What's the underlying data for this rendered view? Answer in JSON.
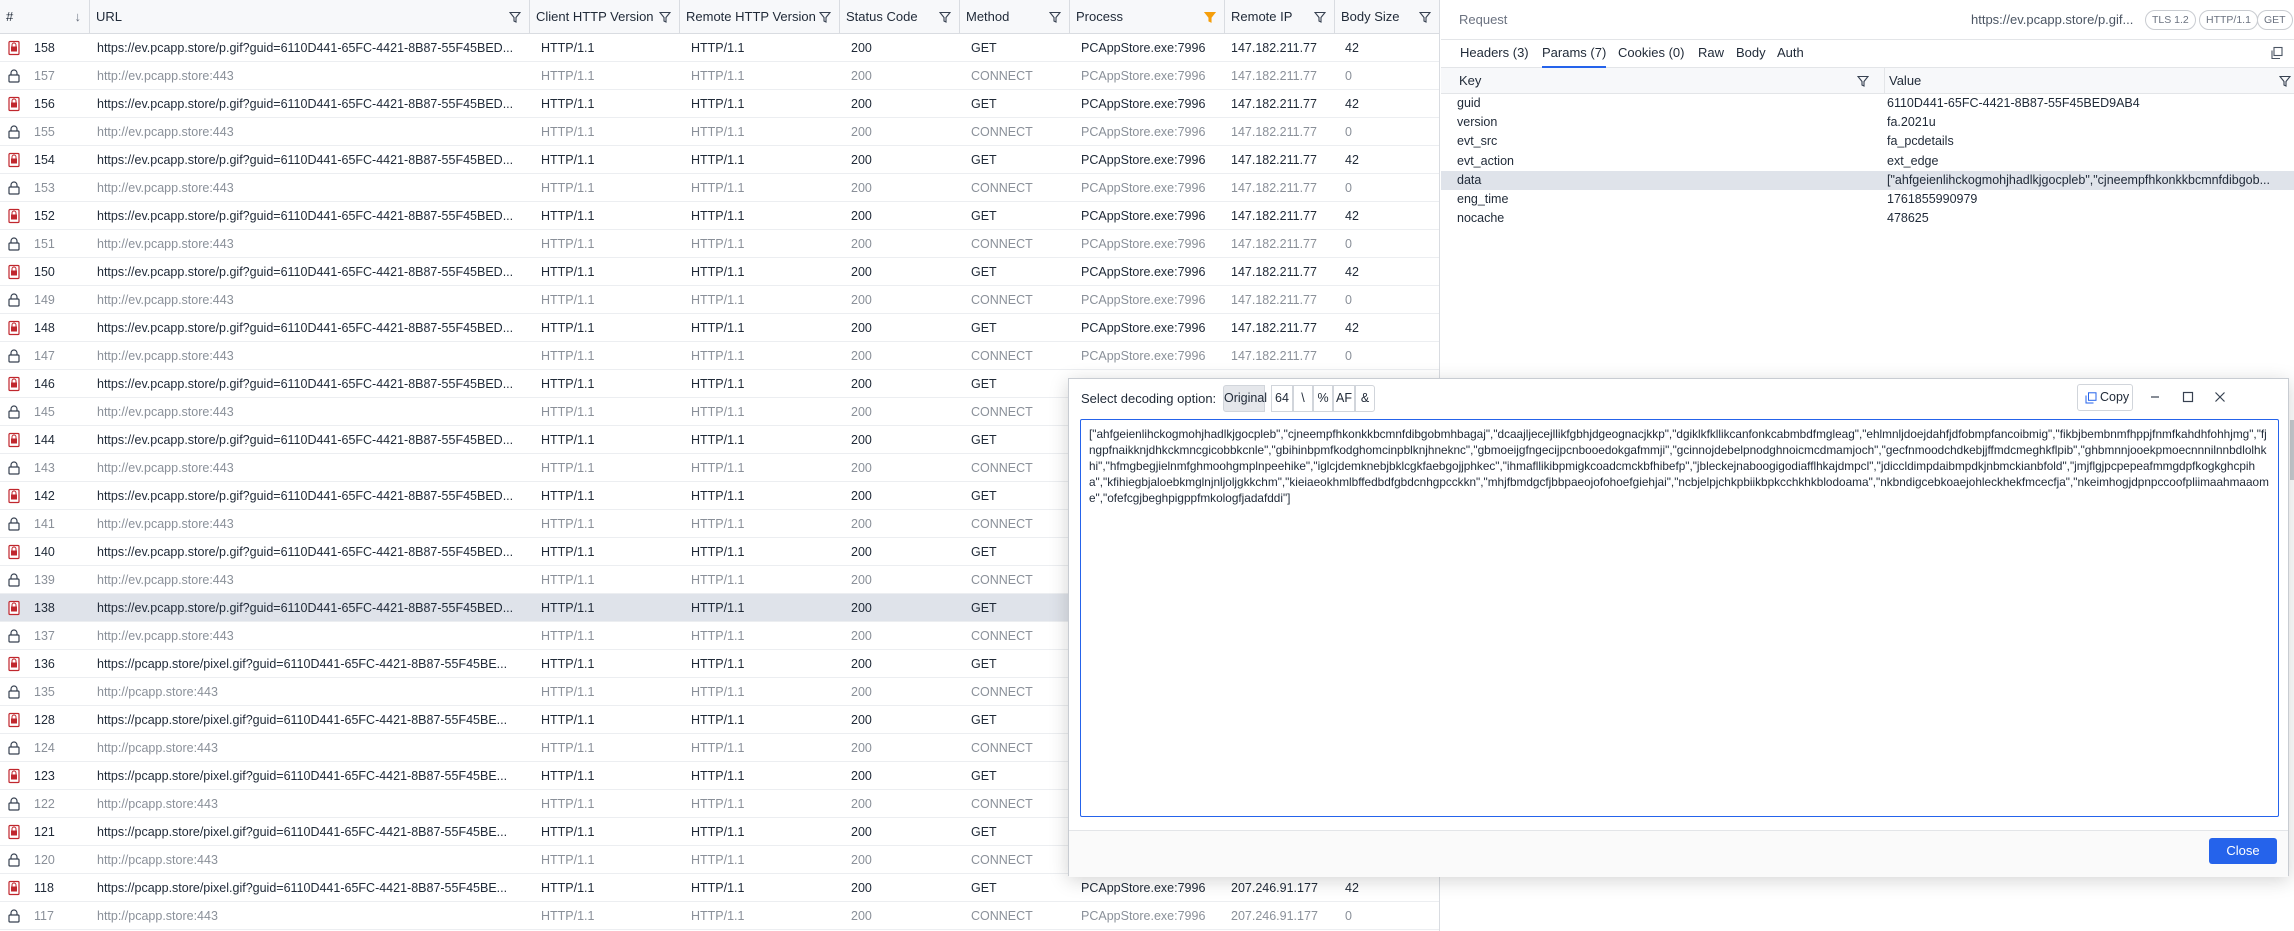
{
  "columns": {
    "num": "#",
    "url": "URL",
    "client_http": "Client HTTP Version",
    "remote_http": "Remote HTTP Version",
    "status": "Status Code",
    "method": "Method",
    "process": "Process",
    "remote_ip": "Remote IP",
    "body_size": "Body Size"
  },
  "colors": {
    "accent": "#2563eb",
    "https_icon": "#c0262d",
    "filter_active": "#f59e0b",
    "selected_row": "#dfe3ea"
  },
  "rows": [
    {
      "num": "158",
      "type": "req",
      "url": "https://ev.pcapp.store/p.gif?guid=6110D441-65FC-4421-8B87-55F45BED...",
      "client": "HTTP/1.1",
      "remote": "HTTP/1.1",
      "status": "200",
      "method": "GET",
      "process": "PCAppStore.exe:7996",
      "ip": "147.182.211.77",
      "size": "42"
    },
    {
      "num": "157",
      "type": "conn",
      "url": "http://ev.pcapp.store:443",
      "client": "HTTP/1.1",
      "remote": "HTTP/1.1",
      "status": "200",
      "method": "CONNECT",
      "process": "PCAppStore.exe:7996",
      "ip": "147.182.211.77",
      "size": "0"
    },
    {
      "num": "156",
      "type": "req",
      "url": "https://ev.pcapp.store/p.gif?guid=6110D441-65FC-4421-8B87-55F45BED...",
      "client": "HTTP/1.1",
      "remote": "HTTP/1.1",
      "status": "200",
      "method": "GET",
      "process": "PCAppStore.exe:7996",
      "ip": "147.182.211.77",
      "size": "42"
    },
    {
      "num": "155",
      "type": "conn",
      "url": "http://ev.pcapp.store:443",
      "client": "HTTP/1.1",
      "remote": "HTTP/1.1",
      "status": "200",
      "method": "CONNECT",
      "process": "PCAppStore.exe:7996",
      "ip": "147.182.211.77",
      "size": "0"
    },
    {
      "num": "154",
      "type": "req",
      "url": "https://ev.pcapp.store/p.gif?guid=6110D441-65FC-4421-8B87-55F45BED...",
      "client": "HTTP/1.1",
      "remote": "HTTP/1.1",
      "status": "200",
      "method": "GET",
      "process": "PCAppStore.exe:7996",
      "ip": "147.182.211.77",
      "size": "42"
    },
    {
      "num": "153",
      "type": "conn",
      "url": "http://ev.pcapp.store:443",
      "client": "HTTP/1.1",
      "remote": "HTTP/1.1",
      "status": "200",
      "method": "CONNECT",
      "process": "PCAppStore.exe:7996",
      "ip": "147.182.211.77",
      "size": "0"
    },
    {
      "num": "152",
      "type": "req",
      "url": "https://ev.pcapp.store/p.gif?guid=6110D441-65FC-4421-8B87-55F45BED...",
      "client": "HTTP/1.1",
      "remote": "HTTP/1.1",
      "status": "200",
      "method": "GET",
      "process": "PCAppStore.exe:7996",
      "ip": "147.182.211.77",
      "size": "42"
    },
    {
      "num": "151",
      "type": "conn",
      "url": "http://ev.pcapp.store:443",
      "client": "HTTP/1.1",
      "remote": "HTTP/1.1",
      "status": "200",
      "method": "CONNECT",
      "process": "PCAppStore.exe:7996",
      "ip": "147.182.211.77",
      "size": "0"
    },
    {
      "num": "150",
      "type": "req",
      "url": "https://ev.pcapp.store/p.gif?guid=6110D441-65FC-4421-8B87-55F45BED...",
      "client": "HTTP/1.1",
      "remote": "HTTP/1.1",
      "status": "200",
      "method": "GET",
      "process": "PCAppStore.exe:7996",
      "ip": "147.182.211.77",
      "size": "42"
    },
    {
      "num": "149",
      "type": "conn",
      "url": "http://ev.pcapp.store:443",
      "client": "HTTP/1.1",
      "remote": "HTTP/1.1",
      "status": "200",
      "method": "CONNECT",
      "process": "PCAppStore.exe:7996",
      "ip": "147.182.211.77",
      "size": "0"
    },
    {
      "num": "148",
      "type": "req",
      "url": "https://ev.pcapp.store/p.gif?guid=6110D441-65FC-4421-8B87-55F45BED...",
      "client": "HTTP/1.1",
      "remote": "HTTP/1.1",
      "status": "200",
      "method": "GET",
      "process": "PCAppStore.exe:7996",
      "ip": "147.182.211.77",
      "size": "42"
    },
    {
      "num": "147",
      "type": "conn",
      "url": "http://ev.pcapp.store:443",
      "client": "HTTP/1.1",
      "remote": "HTTP/1.1",
      "status": "200",
      "method": "CONNECT",
      "process": "PCAppStore.exe:7996",
      "ip": "147.182.211.77",
      "size": "0"
    },
    {
      "num": "146",
      "type": "req",
      "url": "https://ev.pcapp.store/p.gif?guid=6110D441-65FC-4421-8B87-55F45BED...",
      "client": "HTTP/1.1",
      "remote": "HTTP/1.1",
      "status": "200",
      "method": "GET",
      "process": "",
      "ip": "",
      "size": ""
    },
    {
      "num": "145",
      "type": "conn",
      "url": "http://ev.pcapp.store:443",
      "client": "HTTP/1.1",
      "remote": "HTTP/1.1",
      "status": "200",
      "method": "CONNECT",
      "process": "",
      "ip": "",
      "size": ""
    },
    {
      "num": "144",
      "type": "req",
      "url": "https://ev.pcapp.store/p.gif?guid=6110D441-65FC-4421-8B87-55F45BED...",
      "client": "HTTP/1.1",
      "remote": "HTTP/1.1",
      "status": "200",
      "method": "GET",
      "process": "",
      "ip": "",
      "size": ""
    },
    {
      "num": "143",
      "type": "conn",
      "url": "http://ev.pcapp.store:443",
      "client": "HTTP/1.1",
      "remote": "HTTP/1.1",
      "status": "200",
      "method": "CONNECT",
      "process": "",
      "ip": "",
      "size": ""
    },
    {
      "num": "142",
      "type": "req",
      "url": "https://ev.pcapp.store/p.gif?guid=6110D441-65FC-4421-8B87-55F45BED...",
      "client": "HTTP/1.1",
      "remote": "HTTP/1.1",
      "status": "200",
      "method": "GET",
      "process": "",
      "ip": "",
      "size": ""
    },
    {
      "num": "141",
      "type": "conn",
      "url": "http://ev.pcapp.store:443",
      "client": "HTTP/1.1",
      "remote": "HTTP/1.1",
      "status": "200",
      "method": "CONNECT",
      "process": "",
      "ip": "",
      "size": ""
    },
    {
      "num": "140",
      "type": "req",
      "url": "https://ev.pcapp.store/p.gif?guid=6110D441-65FC-4421-8B87-55F45BED...",
      "client": "HTTP/1.1",
      "remote": "HTTP/1.1",
      "status": "200",
      "method": "GET",
      "process": "",
      "ip": "",
      "size": ""
    },
    {
      "num": "139",
      "type": "conn",
      "url": "http://ev.pcapp.store:443",
      "client": "HTTP/1.1",
      "remote": "HTTP/1.1",
      "status": "200",
      "method": "CONNECT",
      "process": "",
      "ip": "",
      "size": ""
    },
    {
      "num": "138",
      "type": "req",
      "sel": true,
      "url": "https://ev.pcapp.store/p.gif?guid=6110D441-65FC-4421-8B87-55F45BED...",
      "client": "HTTP/1.1",
      "remote": "HTTP/1.1",
      "status": "200",
      "method": "GET",
      "process": "",
      "ip": "",
      "size": ""
    },
    {
      "num": "137",
      "type": "conn",
      "url": "http://ev.pcapp.store:443",
      "client": "HTTP/1.1",
      "remote": "HTTP/1.1",
      "status": "200",
      "method": "CONNECT",
      "process": "",
      "ip": "",
      "size": ""
    },
    {
      "num": "136",
      "type": "req",
      "url": "https://pcapp.store/pixel.gif?guid=6110D441-65FC-4421-8B87-55F45BE...",
      "client": "HTTP/1.1",
      "remote": "HTTP/1.1",
      "status": "200",
      "method": "GET",
      "process": "",
      "ip": "",
      "size": ""
    },
    {
      "num": "135",
      "type": "conn",
      "url": "http://pcapp.store:443",
      "client": "HTTP/1.1",
      "remote": "HTTP/1.1",
      "status": "200",
      "method": "CONNECT",
      "process": "",
      "ip": "",
      "size": ""
    },
    {
      "num": "128",
      "type": "req",
      "url": "https://pcapp.store/pixel.gif?guid=6110D441-65FC-4421-8B87-55F45BE...",
      "client": "HTTP/1.1",
      "remote": "HTTP/1.1",
      "status": "200",
      "method": "GET",
      "process": "",
      "ip": "",
      "size": ""
    },
    {
      "num": "124",
      "type": "conn",
      "url": "http://pcapp.store:443",
      "client": "HTTP/1.1",
      "remote": "HTTP/1.1",
      "status": "200",
      "method": "CONNECT",
      "process": "",
      "ip": "",
      "size": ""
    },
    {
      "num": "123",
      "type": "req",
      "url": "https://pcapp.store/pixel.gif?guid=6110D441-65FC-4421-8B87-55F45BE...",
      "client": "HTTP/1.1",
      "remote": "HTTP/1.1",
      "status": "200",
      "method": "GET",
      "process": "",
      "ip": "",
      "size": ""
    },
    {
      "num": "122",
      "type": "conn",
      "url": "http://pcapp.store:443",
      "client": "HTTP/1.1",
      "remote": "HTTP/1.1",
      "status": "200",
      "method": "CONNECT",
      "process": "",
      "ip": "",
      "size": ""
    },
    {
      "num": "121",
      "type": "req",
      "url": "https://pcapp.store/pixel.gif?guid=6110D441-65FC-4421-8B87-55F45BE...",
      "client": "HTTP/1.1",
      "remote": "HTTP/1.1",
      "status": "200",
      "method": "GET",
      "process": "",
      "ip": "",
      "size": ""
    },
    {
      "num": "120",
      "type": "conn",
      "url": "http://pcapp.store:443",
      "client": "HTTP/1.1",
      "remote": "HTTP/1.1",
      "status": "200",
      "method": "CONNECT",
      "process": "",
      "ip": "",
      "size": ""
    },
    {
      "num": "118",
      "type": "req",
      "url": "https://pcapp.store/pixel.gif?guid=6110D441-65FC-4421-8B87-55F45BE...",
      "client": "HTTP/1.1",
      "remote": "HTTP/1.1",
      "status": "200",
      "method": "GET",
      "process": "PCAppStore.exe:7996",
      "ip": "207.246.91.177",
      "size": "42"
    },
    {
      "num": "117",
      "type": "conn",
      "url": "http://pcapp.store:443",
      "client": "HTTP/1.1",
      "remote": "HTTP/1.1",
      "status": "200",
      "method": "CONNECT",
      "process": "PCAppStore.exe:7996",
      "ip": "207.246.91.177",
      "size": "0"
    }
  ],
  "inspector": {
    "section_label": "Request",
    "url": "https://ev.pcapp.store/p.gif...",
    "badges": [
      "TLS 1.2",
      "HTTP/1.1",
      "GET"
    ],
    "tabs": [
      "Headers (3)",
      "Params (7)",
      "Cookies (0)",
      "Raw",
      "Body",
      "Auth"
    ],
    "active_tab": 1,
    "key_header": "Key",
    "value_header": "Value",
    "params": [
      {
        "key": "guid",
        "value": "6110D441-65FC-4421-8B87-55F45BED9AB4"
      },
      {
        "key": "version",
        "value": "fa.2021u"
      },
      {
        "key": "evt_src",
        "value": "fa_pcdetails"
      },
      {
        "key": "evt_action",
        "value": "ext_edge"
      },
      {
        "key": "data",
        "value": "[\"ahfgeienlihckogmohjhadlkjgocpleb\",\"cjneempfhkonkkbcmnfdibgob...",
        "sel": true
      },
      {
        "key": "eng_time",
        "value": "1761855990979"
      },
      {
        "key": "nocache",
        "value": "478625"
      }
    ]
  },
  "dialog": {
    "title": "Select decoding option:",
    "options": [
      "Original",
      "64",
      "\\",
      "%",
      "AF",
      "&"
    ],
    "selected_option": 0,
    "copy_label": "Copy",
    "close_label": "Close",
    "text": "[\"ahfgeienlihckogmohjhadlkjgocpleb\",\"cjneempfhkonkkbcmnfdibgobmhbagaj\",\"dcaajljecejllikfgbhjdgeognacjkkp\",\"dgiklkfkllikcanfonkcabmbdfmgleag\",\"ehlmnljdoejdahfjdfobmpfancoibmig\",\"fikbjbembnmfhppjfnmfkahdhfohhjmg\",\"fjngpfnaikknjdhkckmncgicobbkcnle\",\"gbihinbpmfkodghomcinpblknjhneknc\",\"gbmoeijgfngecijpcnbooedokgafmmji\",\"gcinnojdebelpnodghnoicmcdmamjoch\",\"gecfnmoodchdkebjjffmdcmeghkflpib\",\"ghbmnnjooekpmoecnnnilnnbdlolhkhi\",\"hfmgbegjielnmfghmoohgmplnpeehike\",\"iglcjdemknebjbklcgkfaebgojjphkec\",\"ihmafllikibpmigkcoadcmckbfhibefp\",\"jbleckejnaboogigodiafflhkajdmpcl\",\"jdiccldimpdaibmpdkjnbmckianbfold\",\"jmjflgjpcpepeafmmgdpfkogkghcpiha\",\"kfihiegbjaloebkmglnjnljoljgkkchm\",\"kieiaeokhmlbffedbdfgbdcnhgpcckkn\",\"mhjfbmdgcfjbbpaeojofohoefgiehjai\",\"ncbjelpjchkpbiikbpkcchkhkblodoama\",\"nkbndigcebkoaejohleckhekfmcecfja\",\"nkeimhogjdpnpccoofpliimaahmaaome\",\"ofefcgjbeghpigppfmkologfjadafddi\"]"
  }
}
